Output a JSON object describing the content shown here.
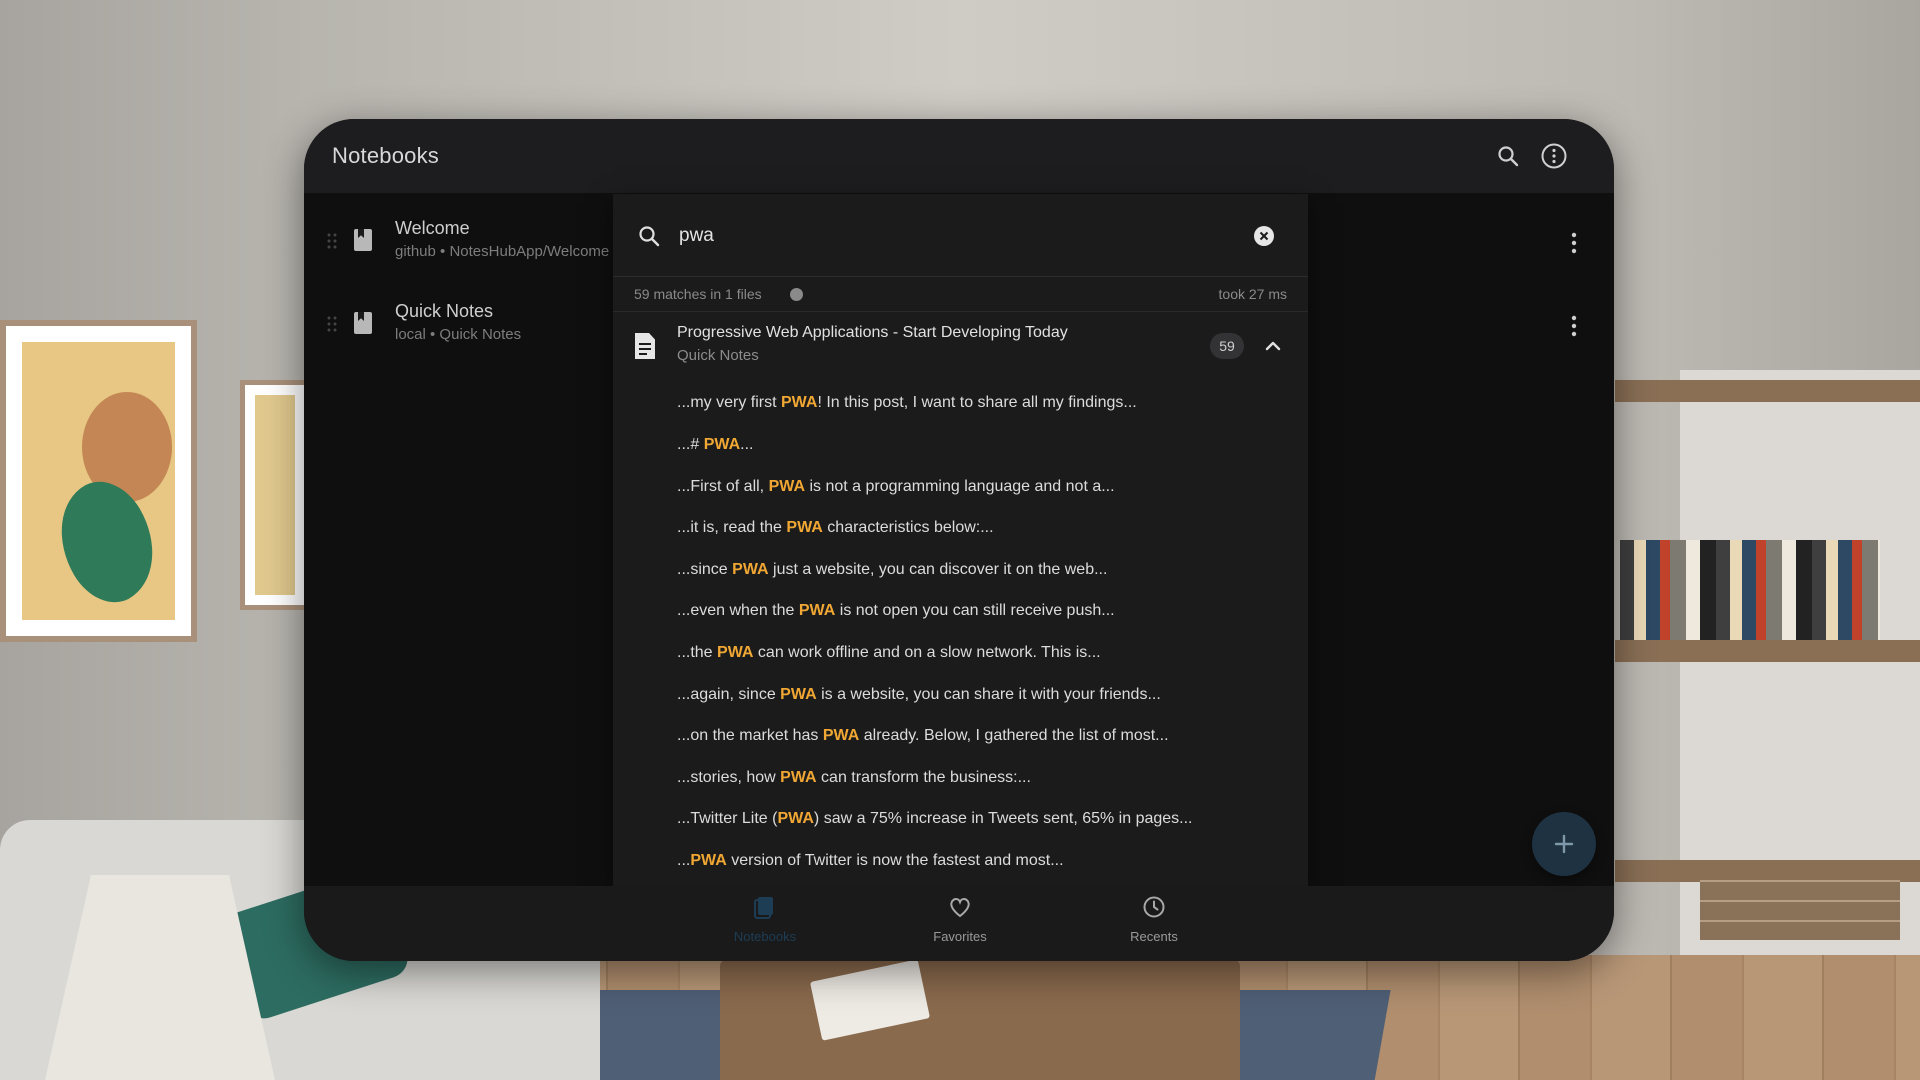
{
  "header": {
    "title": "Notebooks"
  },
  "notebooks": [
    {
      "title": "Welcome",
      "subtitle": "github • NotesHubApp/Welcome"
    },
    {
      "title": "Quick Notes",
      "subtitle": "local • Quick Notes"
    }
  ],
  "search": {
    "query": "pwa",
    "summary": "59 matches in 1 files",
    "timing": "took 27 ms",
    "result_file": {
      "title": "Progressive Web Applications - Start Developing Today",
      "notebook": "Quick Notes",
      "count": "59"
    },
    "matches": [
      {
        "pre": "...my very first ",
        "hl": "PWA",
        "post": "! In this post, I want to share all my findings..."
      },
      {
        "pre": "...# ",
        "hl": "PWA",
        "post": "..."
      },
      {
        "pre": "...First of all, ",
        "hl": "PWA",
        "post": " is not a programming language and not a..."
      },
      {
        "pre": "...it is, read the ",
        "hl": "PWA",
        "post": " characteristics below:..."
      },
      {
        "pre": "...since ",
        "hl": "PWA",
        "post": " just a website, you can discover it on the web..."
      },
      {
        "pre": "...even when the ",
        "hl": "PWA",
        "post": " is not open you can still receive push..."
      },
      {
        "pre": "...the ",
        "hl": "PWA",
        "post": " can work offline and on a slow network. This is..."
      },
      {
        "pre": "...again, since ",
        "hl": "PWA",
        "post": " is a website, you can share it with your friends..."
      },
      {
        "pre": "...on the market has ",
        "hl": "PWA",
        "post": " already. Below, I gathered the list of most..."
      },
      {
        "pre": "...stories, how ",
        "hl": "PWA",
        "post": " can transform the business:..."
      },
      {
        "pre": "...Twitter Lite (",
        "hl": "PWA",
        "post": ") saw a 75% increase in Tweets sent, 65% in pages..."
      },
      {
        "pre": "...",
        "hl": "PWA",
        "post": " version of Twitter is now the fastest and most..."
      }
    ]
  },
  "bottom_nav": [
    {
      "label": "Notebooks",
      "icon": "notebooks-icon",
      "active": true
    },
    {
      "label": "Favorites",
      "icon": "heart-icon",
      "active": false
    },
    {
      "label": "Recents",
      "icon": "clock-icon",
      "active": false
    }
  ],
  "colors": {
    "highlight": "#f0a733",
    "background": "#0f0f10",
    "panel": "#1b1b1c",
    "accent": "#1d3d55"
  }
}
